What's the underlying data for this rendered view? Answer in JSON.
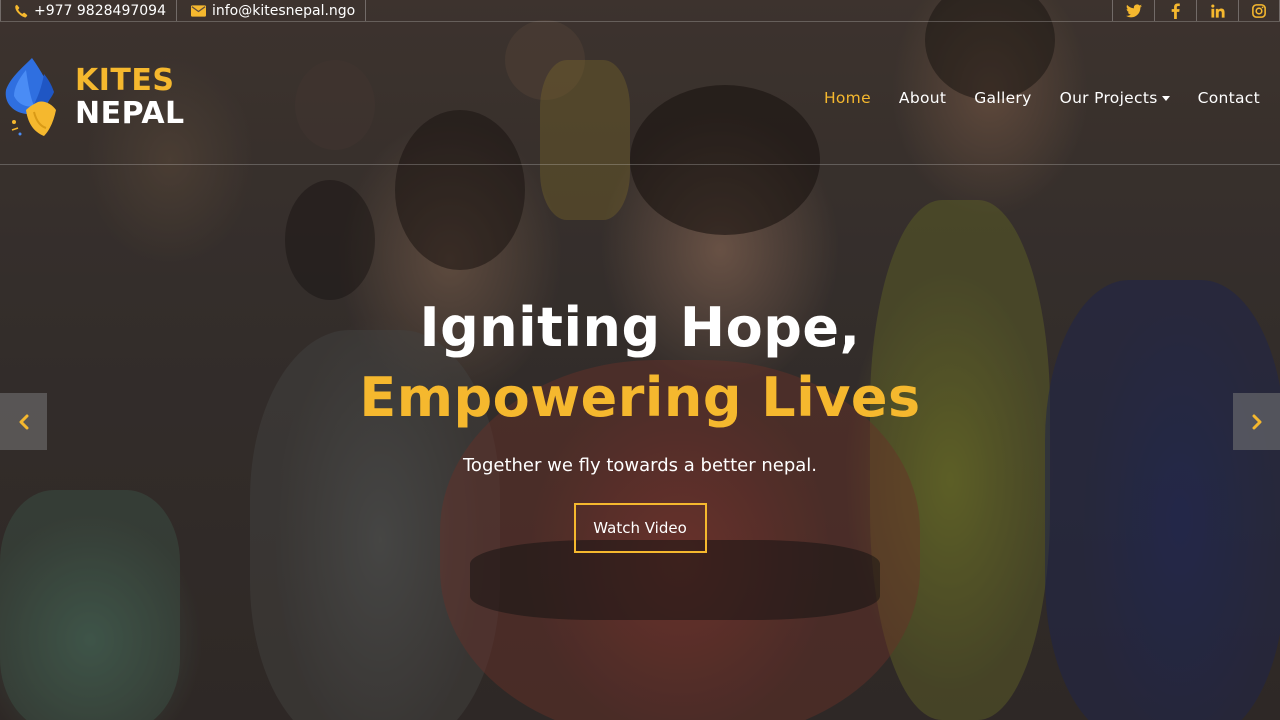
{
  "topbar": {
    "phone": "+977 9828497094",
    "email": "info@kitesnepal.ngo",
    "phone_icon": "phone-icon",
    "email_icon": "envelope-icon",
    "socials": [
      "twitter-icon",
      "facebook-icon",
      "linkedin-icon",
      "instagram-icon"
    ]
  },
  "logo": {
    "line1": "KITES",
    "line2": "NEPAL",
    "icon": "kite-logo-icon"
  },
  "nav": {
    "items": [
      {
        "label": "Home",
        "active": true
      },
      {
        "label": "About",
        "active": false
      },
      {
        "label": "Gallery",
        "active": false
      },
      {
        "label": "Our Projects",
        "active": false,
        "dropdown": true
      },
      {
        "label": "Contact",
        "active": false
      }
    ]
  },
  "hero": {
    "line1": "Igniting Hope,",
    "line2": "Empowering Lives",
    "subtitle": "Together we fly towards a better nepal.",
    "button_label": "Watch Video"
  },
  "slider": {
    "prev_icon": "chevron-left-icon",
    "next_icon": "chevron-right-icon"
  },
  "colors": {
    "accent": "#f5b82e",
    "text": "#ffffff"
  }
}
